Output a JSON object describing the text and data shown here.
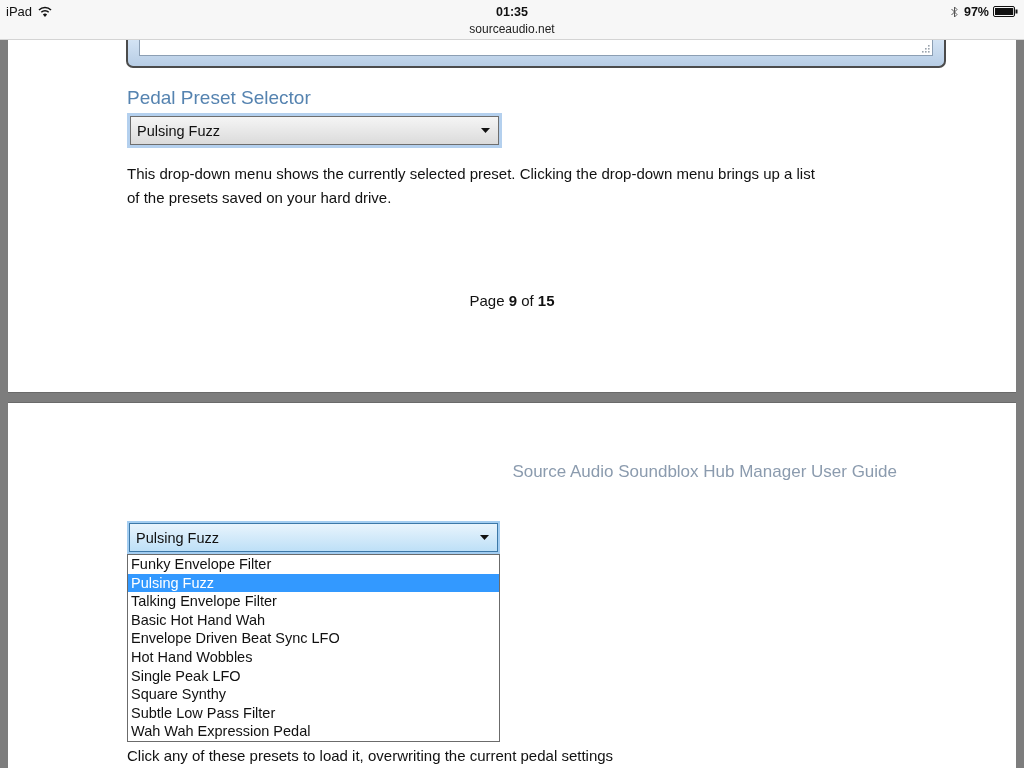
{
  "status_bar": {
    "device": "iPad",
    "time": "01:35",
    "url": "sourceaudio.net",
    "battery": "97%"
  },
  "pages": [
    {
      "kind": "end",
      "section_title": "Pedal Preset Selector",
      "dropdown": {
        "value": "Pulsing Fuzz",
        "expanded": false
      },
      "paragraph": "This drop-down menu shows the currently selected preset. Clicking the drop-down menu brings up a list of the presets saved on your hard drive.",
      "footer": "Page **9** of **15**"
    },
    {
      "kind": "start",
      "header": "Source Audio Soundblox Hub Manager User Guide",
      "dropdown": {
        "value": "Pulsing Fuzz",
        "expanded": true,
        "options": [
          {
            "label": "Funky Envelope Filter",
            "selected": false
          },
          {
            "label": "Pulsing Fuzz",
            "selected": true
          },
          {
            "label": "Talking Envelope Filter",
            "selected": false
          },
          {
            "label": "Basic Hot Hand Wah",
            "selected": false
          },
          {
            "label": "Envelope Driven Beat Sync LFO",
            "selected": false
          },
          {
            "label": "Hot Hand Wobbles",
            "selected": false
          },
          {
            "label": "Single Peak LFO",
            "selected": false
          },
          {
            "label": "Square Synthy",
            "selected": false
          },
          {
            "label": "Subtle Low Pass Filter",
            "selected": false
          },
          {
            "label": "Wah Wah Expression Pedal",
            "selected": false
          }
        ]
      },
      "paragraph": "Click any of these presets to load it, overwriting the current pedal settings"
    }
  ]
}
